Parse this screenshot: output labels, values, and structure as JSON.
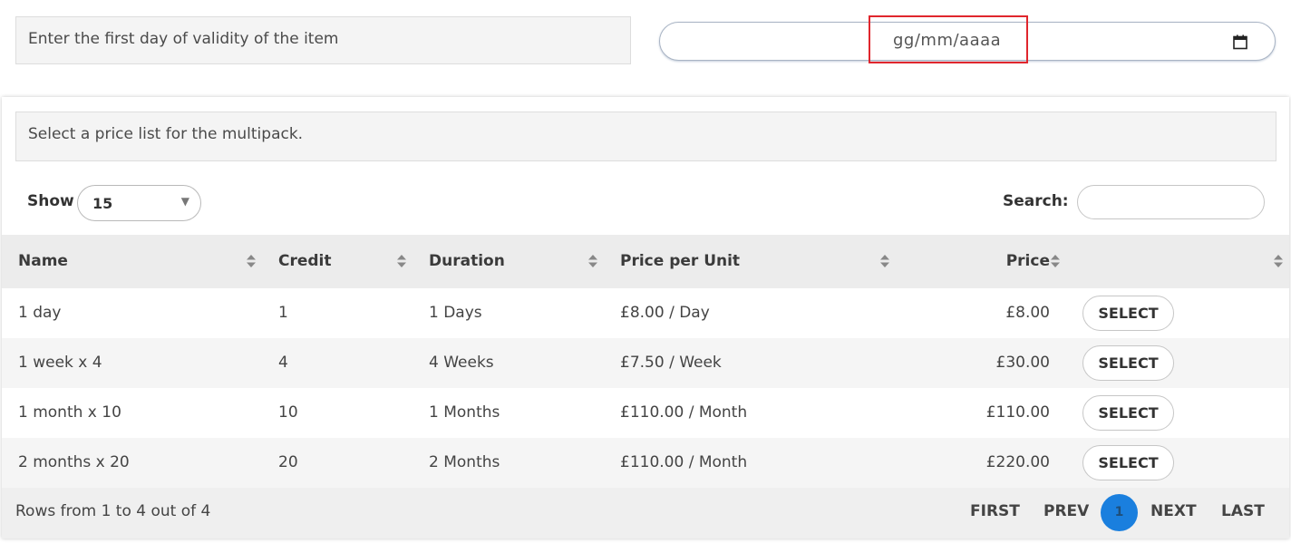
{
  "validity": {
    "label": "Enter the first day of validity of the item",
    "date_placeholder": "gg/mm/aaaa",
    "calendar_icon": "calendar-icon"
  },
  "price_list": {
    "label": "Select a price list for the multipack.",
    "show_label": "Show",
    "show_value": "15",
    "search_label": "Search:",
    "search_value": ""
  },
  "table": {
    "columns": [
      "Name",
      "Credit",
      "Duration",
      "Price per Unit",
      "Price",
      ""
    ],
    "rows": [
      {
        "name": "1 day",
        "credit": "1",
        "duration": "1 Days",
        "unit_price": "£8.00 / Day",
        "price": "£8.00",
        "action": "SELECT"
      },
      {
        "name": "1 week x 4",
        "credit": "4",
        "duration": "4 Weeks",
        "unit_price": "£7.50 / Week",
        "price": "£30.00",
        "action": "SELECT"
      },
      {
        "name": "1 month x 10",
        "credit": "10",
        "duration": "1 Months",
        "unit_price": "£110.00 / Month",
        "price": "£110.00",
        "action": "SELECT"
      },
      {
        "name": "2 months x 20",
        "credit": "20",
        "duration": "2 Months",
        "unit_price": "£110.00 / Month",
        "price": "£220.00",
        "action": "SELECT"
      }
    ]
  },
  "footer": {
    "info": "Rows from 1 to 4 out of 4",
    "first": "FIRST",
    "prev": "PREV",
    "current_page": "1",
    "next": "NEXT",
    "last": "LAST"
  },
  "colors": {
    "highlight": "#e0262d",
    "page_active": "#1a7fde"
  }
}
